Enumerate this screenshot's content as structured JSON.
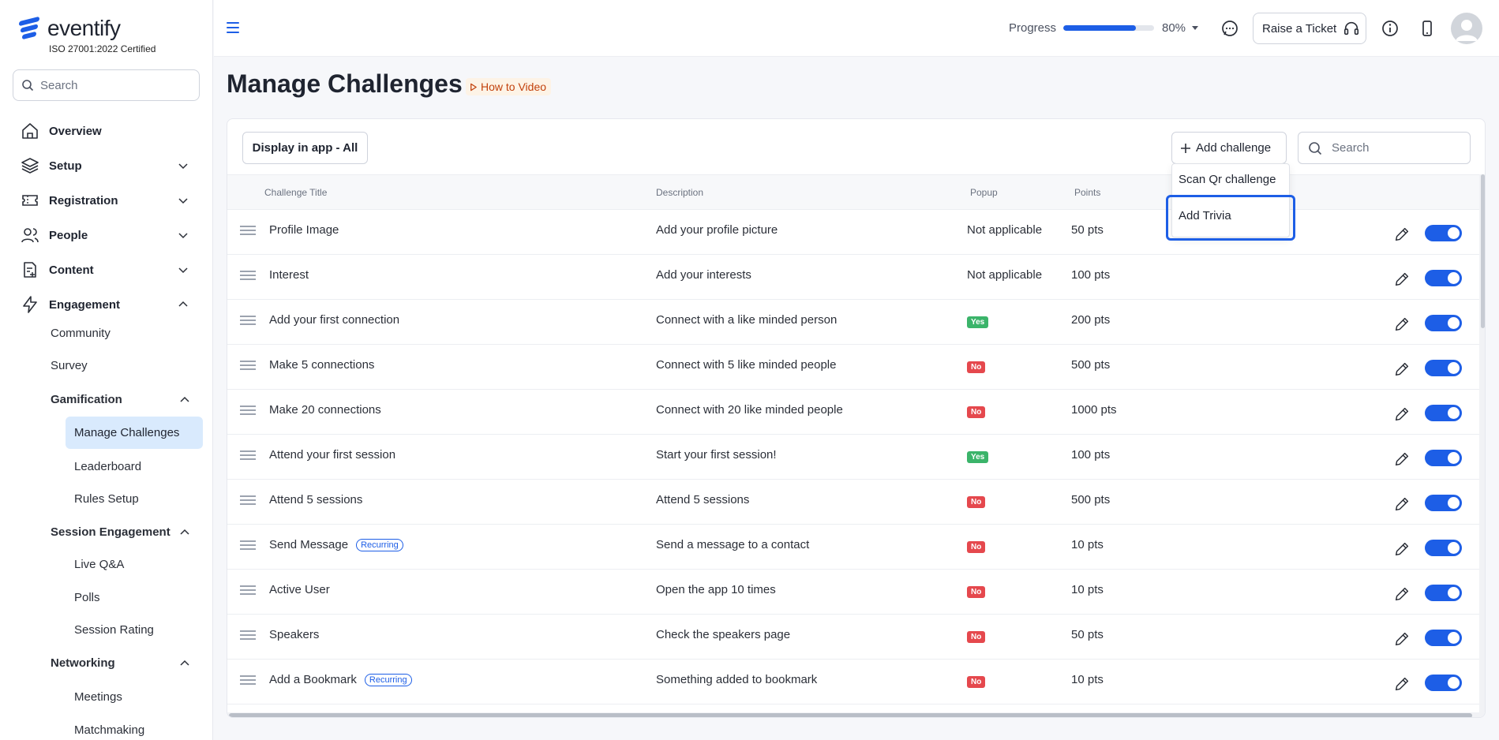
{
  "brand": {
    "name": "eventify",
    "certification": "ISO 27001:2022 Certified",
    "accent": "#1d5ee6"
  },
  "sidebar": {
    "search_placeholder": "Search",
    "items": [
      {
        "label": "Overview",
        "icon": "home-icon"
      },
      {
        "label": "Setup",
        "icon": "layers-icon"
      },
      {
        "label": "Registration",
        "icon": "ticket-icon"
      },
      {
        "label": "People",
        "icon": "users-icon"
      },
      {
        "label": "Content",
        "icon": "file-plus-icon"
      },
      {
        "label": "Engagement",
        "icon": "lightning-icon"
      }
    ],
    "engagement": {
      "community": "Community",
      "survey": "Survey",
      "gamification": "Gamification",
      "manage_challenges": "Manage Challenges",
      "leaderboard": "Leaderboard",
      "rules_setup": "Rules Setup",
      "session_engagement": "Session Engagement",
      "live_qa": "Live Q&A",
      "polls": "Polls",
      "session_rating": "Session Rating",
      "networking": "Networking",
      "meetings": "Meetings",
      "matchmaking": "Matchmaking"
    }
  },
  "header": {
    "progress_label": "Progress",
    "progress_fraction": 0.8,
    "progress_value": "80%",
    "raise_ticket": "Raise a Ticket"
  },
  "page": {
    "title": "Manage Challenges",
    "how_to": "How to Video",
    "display_filter": "Display in app - All",
    "add_challenge": "Add challenge",
    "search_placeholder": "Search"
  },
  "dropdown": {
    "items": [
      "Scan Qr challenge",
      "Add Trivia"
    ]
  },
  "table": {
    "columns": [
      "Challenge Title",
      "Description",
      "Popup",
      "Points"
    ],
    "rows": [
      {
        "title": "Profile Image",
        "description": "Add your profile picture",
        "popup": "Not applicable",
        "points": "50 pts"
      },
      {
        "title": "Interest",
        "description": "Add your interests",
        "popup": "Not applicable",
        "points": "100 pts"
      },
      {
        "title": "Add your first connection",
        "description": "Connect with a like minded person",
        "popup": "Yes",
        "points": "200 pts"
      },
      {
        "title": "Make 5 connections",
        "description": "Connect with 5 like minded people",
        "popup": "No",
        "points": "500 pts"
      },
      {
        "title": "Make 20 connections",
        "description": "Connect with 20 like minded people",
        "popup": "No",
        "points": "1000 pts"
      },
      {
        "title": "Attend your first session",
        "description": "Start your first session!",
        "popup": "Yes",
        "points": "100 pts"
      },
      {
        "title": "Attend 5 sessions",
        "description": "Attend 5 sessions",
        "popup": "No",
        "points": "500 pts"
      },
      {
        "title": "Send Message",
        "tag": "Recurring",
        "description": "Send a message to a contact",
        "popup": "No",
        "points": "10 pts"
      },
      {
        "title": "Active User",
        "description": "Open the app 10 times",
        "popup": "No",
        "points": "10 pts"
      },
      {
        "title": "Speakers",
        "description": "Check the speakers page",
        "popup": "No",
        "points": "50 pts"
      },
      {
        "title": "Add a Bookmark",
        "tag": "Recurring",
        "description": "Something added to bookmark",
        "popup": "No",
        "points": "10 pts"
      }
    ],
    "colors": {
      "yes": "#3bb46a",
      "no": "#e5484d"
    }
  }
}
